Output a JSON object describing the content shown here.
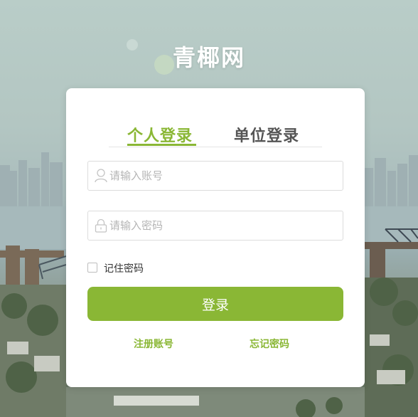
{
  "site": {
    "title": "青椰网"
  },
  "login": {
    "tabs": [
      {
        "label": "个人登录",
        "active": true
      },
      {
        "label": "单位登录",
        "active": false
      }
    ],
    "username": {
      "placeholder": "请输入账号",
      "value": "",
      "icon": "user-icon"
    },
    "password": {
      "placeholder": "请输入密码",
      "value": "",
      "icon": "lock-icon"
    },
    "remember": {
      "label": "记住密码",
      "checked": false
    },
    "submit_label": "登录",
    "register_label": "注册账号",
    "forgot_label": "忘记密码"
  },
  "colors": {
    "accent": "#8ab735",
    "card": "#ffffff",
    "tab_inactive": "#555555"
  }
}
